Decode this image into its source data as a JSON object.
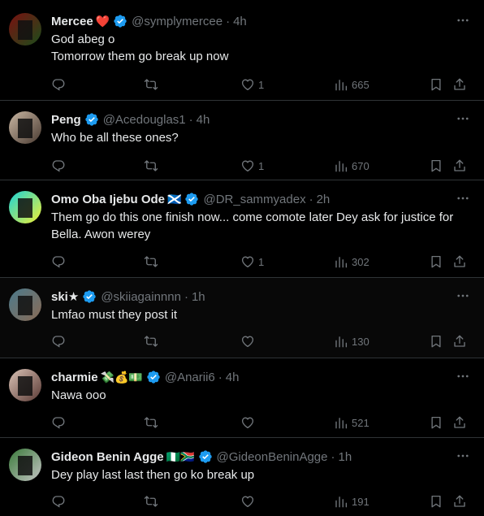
{
  "colors": {
    "background": "#000000",
    "text": "#e7e9ea",
    "muted": "#71767b",
    "divider": "#2f3336",
    "verified": "#1d9bf0"
  },
  "tweets": [
    {
      "name": "Mercee",
      "emoji": "❤️",
      "handle": "@symplymercee",
      "time": "4h",
      "lines": [
        "God abeg o",
        "Tomorrow them go break up now"
      ],
      "likes": "1",
      "views": "665",
      "avatar_colors": [
        "#7a1010",
        "#1b4d1b"
      ]
    },
    {
      "name": "Peng",
      "emoji": "",
      "handle": "@Acedouglas1",
      "time": "4h",
      "lines": [
        "Who be all these ones?"
      ],
      "likes": "1",
      "views": "670",
      "avatar_colors": [
        "#c9b7a3",
        "#4a3b32"
      ]
    },
    {
      "name": "Omo Oba Ijebu Ode",
      "emoji": "🏴󠁧󠁢󠁳󠁣󠁴󠁿",
      "handle": "@DR_sammyadex",
      "time": "2h",
      "lines": [
        "Them go do this one finish now... come comote later Dey ask for justice for",
        "Bella. Awon werey"
      ],
      "likes": "1",
      "views": "302",
      "avatar_colors": [
        "#19d3d8",
        "#f2f034"
      ]
    },
    {
      "name": "ski★",
      "emoji": "",
      "handle": "@skiiagainnnn",
      "time": "1h",
      "lines": [
        "Lmfao must they post it"
      ],
      "likes": "",
      "views": "130",
      "avatar_colors": [
        "#4b7a8c",
        "#8a6b55"
      ]
    },
    {
      "name": "charmie",
      "emoji": "💸💰💵",
      "handle": "@Anarii6",
      "time": "4h",
      "lines": [
        "Nawa ooo"
      ],
      "likes": "",
      "views": "521",
      "avatar_colors": [
        "#d9c2b5",
        "#5a3a35"
      ]
    },
    {
      "name": "Gideon Benin Agge",
      "emoji": "🇳🇬🇿🇦",
      "handle": "@GideonBeninAgge",
      "time": "1h",
      "lines": [
        "Dey play last last then go ko break up"
      ],
      "likes": "",
      "views": "191",
      "avatar_colors": [
        "#3a7a3a",
        "#c4c4c4"
      ]
    }
  ]
}
